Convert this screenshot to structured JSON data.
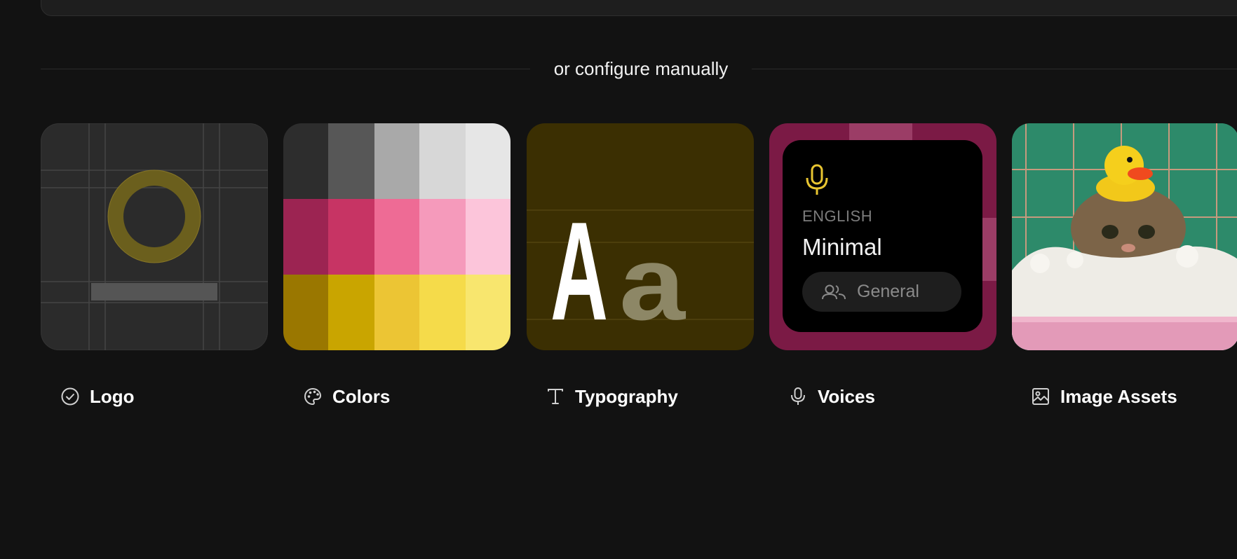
{
  "divider": {
    "label": "or configure manually"
  },
  "cards": {
    "logo": {
      "label": "Logo",
      "icon": "check-circle-icon"
    },
    "colors": {
      "label": "Colors",
      "icon": "palette-icon",
      "swatches": [
        [
          "#2d2d2d",
          "#575757",
          "#a9a9a9",
          "#d7d7d7",
          "#e6e6e6"
        ],
        [
          "#9c2452",
          "#c73464",
          "#ee6b95",
          "#f59abb",
          "#fcc5da"
        ],
        [
          "#9a7700",
          "#c9a500",
          "#ecc534",
          "#f5db4a",
          "#f8e66e"
        ]
      ]
    },
    "typography": {
      "label": "Typography",
      "icon": "type-icon",
      "sample_upper": "A",
      "sample_lower": "a"
    },
    "voices": {
      "label": "Voices",
      "icon": "microphone-icon",
      "language": "ENGLISH",
      "voice_name": "Minimal",
      "pill_label": "General"
    },
    "image_assets": {
      "label": "Image Assets",
      "icon": "image-icon"
    }
  },
  "colors": {
    "background": "#121212",
    "accent_yellow": "#e8c531",
    "voices_frame": "#7b1a45",
    "typography_bg": "#3b2f02"
  }
}
